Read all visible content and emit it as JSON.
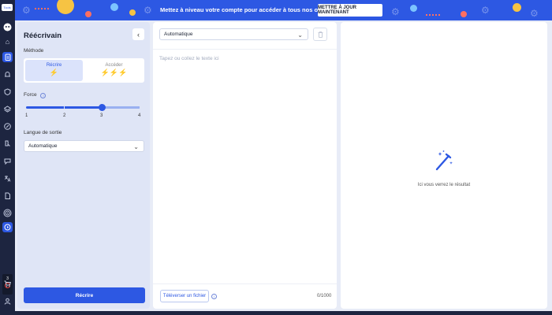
{
  "banner": {
    "message": "Mettez à niveau votre compte pour accéder à tous nos outils",
    "cta": "METTRE À JOUR MAINTENANT"
  },
  "rail": {
    "tag": "Tools",
    "badge_count": "3",
    "icons": [
      "home-icon",
      "clipboard-icon",
      "bell-icon",
      "shield-icon",
      "layers-icon",
      "edit-icon",
      "puzzle-icon",
      "chat-icon",
      "translate-icon",
      "file-icon",
      "target-icon",
      "rewrite-icon",
      "cart-icon",
      "user-icon"
    ]
  },
  "left_panel": {
    "title": "Réécrivain",
    "method_label": "Méthode",
    "methods": [
      {
        "label": "Récrire",
        "bolts": "⚡"
      },
      {
        "label": "Accéder",
        "bolts": "⚡⚡⚡"
      }
    ],
    "force_label": "Force",
    "force_ticks": [
      "1",
      "2",
      "3",
      "4"
    ],
    "force_value": 3,
    "output_lang_label": "Langue de sortie",
    "output_lang_value": "Automatique",
    "submit_label": "Récrire"
  },
  "middle_panel": {
    "language_value": "Automatique",
    "placeholder": "Tapez ou collez le texte ici",
    "upload_label": "Téléverser un fichier",
    "char_count": "0/1000"
  },
  "right_panel": {
    "result_placeholder": "Ici vous verrez le résultat"
  },
  "colors": {
    "accent": "#2d58e3",
    "rail": "#1d2540",
    "panel_bg": "#dfe5f6"
  }
}
